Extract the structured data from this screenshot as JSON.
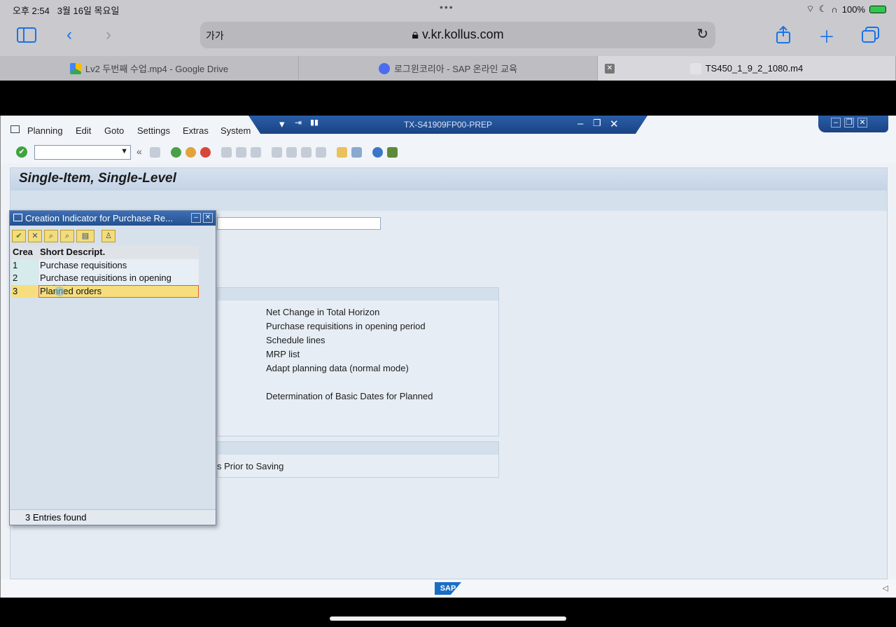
{
  "status": {
    "time": "오후 2:54",
    "date": "3월 16일 목요일",
    "battery": "100%"
  },
  "browser": {
    "text_size_label": "가가",
    "url": "v.kr.kollus.com",
    "tabs": [
      {
        "label": "Lv2 두번째 수업.mp4 - Google Drive"
      },
      {
        "label": "로그윈코리아 - SAP 온라인 교육"
      },
      {
        "label": "TS450_1_9_2_1080.m4"
      }
    ]
  },
  "sap": {
    "menu": [
      "Planning",
      "Edit",
      "Goto",
      "Settings",
      "Extras",
      "System"
    ],
    "system_title": "TX-S41909FP00-PREP",
    "screen_title": "Single-Item, Single-Level",
    "options": [
      "Net Change in Total Horizon",
      "Purchase requisitions in opening period",
      "Schedule lines",
      "MRP list",
      "Adapt planning data (normal mode)",
      "Determination of Basic Dates for Planned"
    ],
    "group2_text": "s Prior to Saving"
  },
  "popup": {
    "title": "Creation Indicator for Purchase Re...",
    "columns": [
      "Crea",
      "Short Descript."
    ],
    "rows": [
      {
        "code": "1",
        "desc": "Purchase requisitions"
      },
      {
        "code": "2",
        "desc": "Purchase requisitions in opening period"
      },
      {
        "code": "3",
        "desc": "Planned orders"
      }
    ],
    "selected_row": 3,
    "status": "3 Entries found"
  },
  "colors": {
    "sap_blue": "#23518f",
    "selection": "#f6de7f",
    "safari_accent": "#1a73e8"
  }
}
